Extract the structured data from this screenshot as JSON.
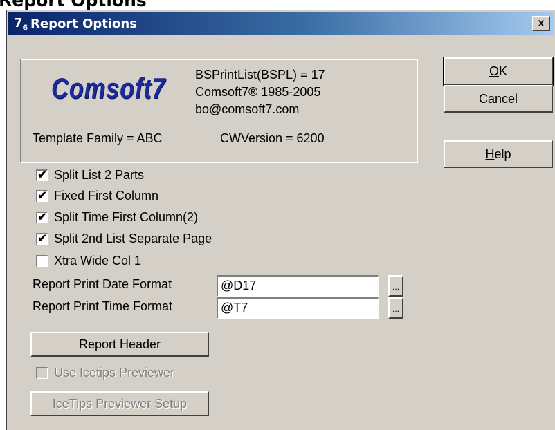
{
  "page_title": "Report Options",
  "window": {
    "title": "Report Options",
    "icon_text": "7",
    "icon_sub": "6",
    "close_label": "x"
  },
  "info": {
    "logo": "Comsoft7",
    "line1": "BSPrintList(BSPL) = 17",
    "line2": "Comsoft7® 1985-2005",
    "line3": "bo@comsoft7.com",
    "template_family": "Template Family = ABC",
    "cwversion": "CWVersion = 6200"
  },
  "buttons": {
    "ok": {
      "prefix": "",
      "mnemonic": "O",
      "rest": "K"
    },
    "cancel": "Cancel",
    "help": {
      "prefix": "",
      "mnemonic": "H",
      "rest": "elp"
    },
    "report_header": "Report Header",
    "previewer_setup": "IceTips Previewer Setup"
  },
  "checkboxes": [
    {
      "label": "Split List 2 Parts",
      "checked": true,
      "mark": "✔",
      "enabled": true
    },
    {
      "label": "Fixed First Column",
      "checked": true,
      "mark": "✔",
      "enabled": true
    },
    {
      "label": "Split Time First Column(2)",
      "checked": true,
      "mark": "✔",
      "enabled": true
    },
    {
      "label": "Split 2nd List Separate Page",
      "checked": true,
      "mark": "✔",
      "enabled": true
    },
    {
      "label": "Xtra Wide Col 1",
      "checked": false,
      "mark": "",
      "enabled": true
    },
    {
      "label": "Use Icetips Previewer",
      "checked": false,
      "mark": "",
      "enabled": false
    }
  ],
  "fields": {
    "date_format": {
      "label": "Report Print Date Format",
      "value": "@D17",
      "button": "..."
    },
    "time_format": {
      "label": "Report Print Time Format",
      "value": "@T7",
      "button": "..."
    }
  },
  "colors": {
    "dialog_bg": "#d4d0c8",
    "title_start": "#0a246a",
    "title_end": "#a6caf0",
    "logo": "#1a2a9a"
  }
}
